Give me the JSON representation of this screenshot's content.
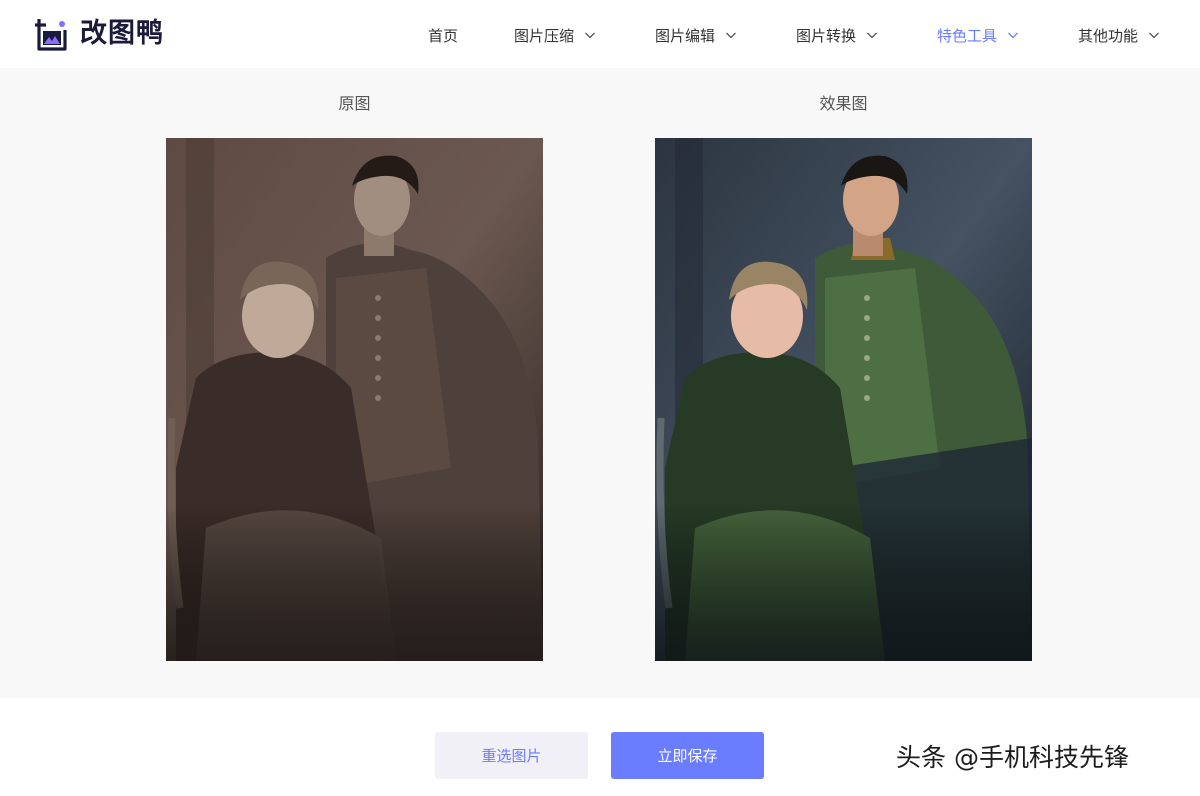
{
  "brand": {
    "name": "改图鸭",
    "accent": "#6a7cff",
    "logo_icon": "photo-frame-icon"
  },
  "nav": {
    "items": [
      {
        "label": "首页",
        "has_dropdown": false,
        "active": false
      },
      {
        "label": "图片压缩",
        "has_dropdown": true,
        "active": false
      },
      {
        "label": "图片编辑",
        "has_dropdown": true,
        "active": false
      },
      {
        "label": "图片转换",
        "has_dropdown": true,
        "active": false
      },
      {
        "label": "特色工具",
        "has_dropdown": true,
        "active": true
      },
      {
        "label": "其他功能",
        "has_dropdown": true,
        "active": false
      }
    ]
  },
  "compare": {
    "original_label": "原图",
    "result_label": "效果图"
  },
  "actions": {
    "reselect_label": "重选图片",
    "save_label": "立即保存"
  },
  "watermark": "头条 @手机科技先锋"
}
